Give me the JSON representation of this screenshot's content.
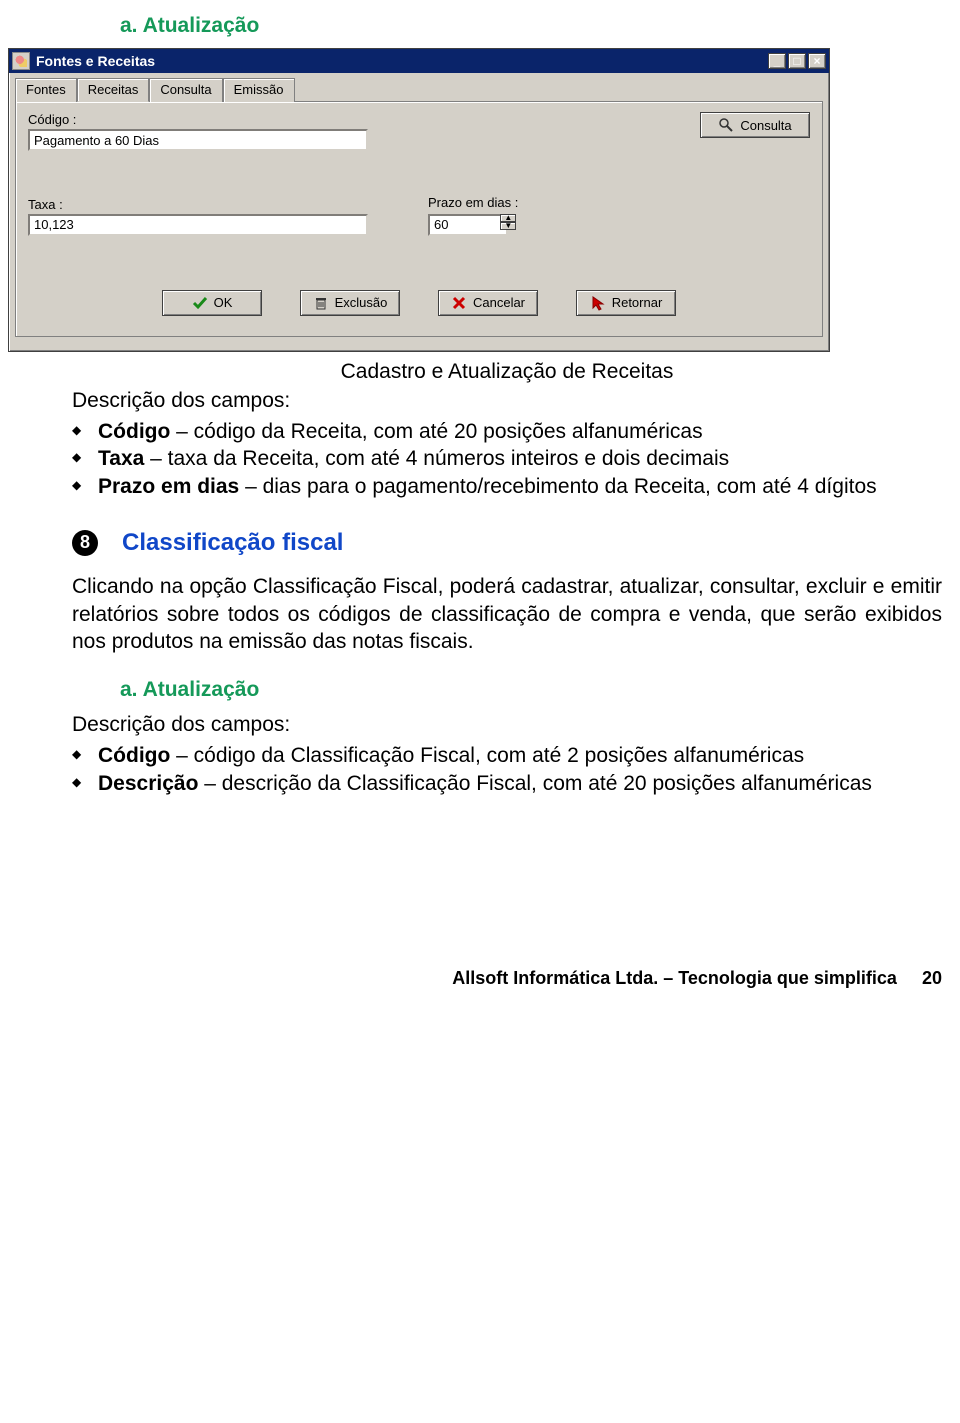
{
  "headings": {
    "a_atualizacao": "a.  Atualização",
    "a_atualizacao2": "a.  Atualização"
  },
  "window": {
    "title": "Fontes e Receitas",
    "tabs": {
      "fontes": "Fontes",
      "receitas": "Receitas",
      "consulta": "Consulta",
      "emissao": "Emissão"
    },
    "labels": {
      "codigo": "Código :",
      "taxa": "Taxa :",
      "prazo": "Prazo em dias :"
    },
    "values": {
      "codigo": "Pagamento a 60 Dias",
      "taxa": "10,123",
      "prazo": "60"
    },
    "buttons": {
      "consulta": "Consulta",
      "ok": "OK",
      "exclusao": "Exclusão",
      "cancelar": "Cancelar",
      "retornar": "Retornar"
    }
  },
  "caption": "Cadastro e Atualização de Receitas",
  "desc_campos": "Descrição dos campos:",
  "bullets1": [
    {
      "b": "Código",
      "t": " – código da Receita, com até 20 posições alfanuméricas"
    },
    {
      "b": "Taxa",
      "t": " – taxa da Receita, com até 4 números inteiros e dois decimais"
    },
    {
      "b": "Prazo em dias",
      "t": " – dias para o pagamento/recebimento da Receita, com até 4 dígitos"
    }
  ],
  "section8": {
    "num": "8",
    "title": "Classificação fiscal"
  },
  "para8": "Clicando na opção Classificação Fiscal, poderá cadastrar, atualizar, consultar, excluir e emitir relatórios sobre todos os códigos de classificação de compra e venda, que serão exibidos nos produtos na emissão das notas fiscais.",
  "bullets2": [
    {
      "b": "Código",
      "t": " – código da Classificação Fiscal, com até 2 posições alfanuméricas"
    },
    {
      "b": "Descrição",
      "t": " – descrição da Classificação Fiscal, com até 20 posições alfanuméricas"
    }
  ],
  "footer": {
    "company": "Allsoft Informática Ltda. – Tecnologia que simplifica",
    "page": "20"
  }
}
